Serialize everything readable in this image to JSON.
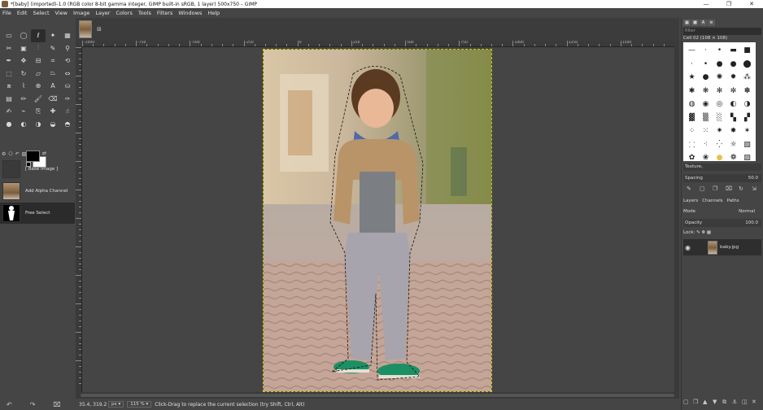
{
  "window": {
    "title": "*[baby] (imported)-1.0 (RGB color 8-bit gamma integer, GIMP built-in sRGB, 1 layer) 500x750 – GIMP",
    "controls": [
      "—",
      "❐",
      "✕"
    ]
  },
  "menu": [
    "File",
    "Edit",
    "Select",
    "View",
    "Image",
    "Layer",
    "Colors",
    "Tools",
    "Filters",
    "Windows",
    "Help"
  ],
  "history": {
    "items": [
      {
        "label": "[ Base Image ]",
        "thumb": "blank"
      },
      {
        "label": "Add Alpha Channel",
        "thumb": "photo"
      },
      {
        "label": "Free Select",
        "thumb": "silhouette"
      }
    ]
  },
  "ruler": {
    "h_labels": [
      "-1000",
      "-750",
      "-500",
      "-250",
      "0",
      "250",
      "500",
      "750",
      "1000",
      "1250",
      "1500"
    ]
  },
  "status": {
    "coords": "35.4, 319.2",
    "unit": "px ▾",
    "zoom": "115 % ▾",
    "message": "Click-Drag to replace the current selection (try Shift, Ctrl, Alt)"
  },
  "brushes": {
    "filter_placeholder": "filter",
    "current": "Cell 02 (108 × 108)",
    "texture": "Texture,",
    "spacing_label": "Spacing",
    "spacing_value": "50.0"
  },
  "layers": {
    "tabs": [
      "Layers",
      "Channels",
      "Paths"
    ],
    "mode_label": "Mode",
    "mode_value": "Normal",
    "opacity_label": "Opacity",
    "opacity_value": "100.0",
    "lock_label": "Lock:",
    "layer_name": "baby.jpg"
  },
  "colors": {
    "fg": "#000000",
    "bg": "#ffffff"
  }
}
